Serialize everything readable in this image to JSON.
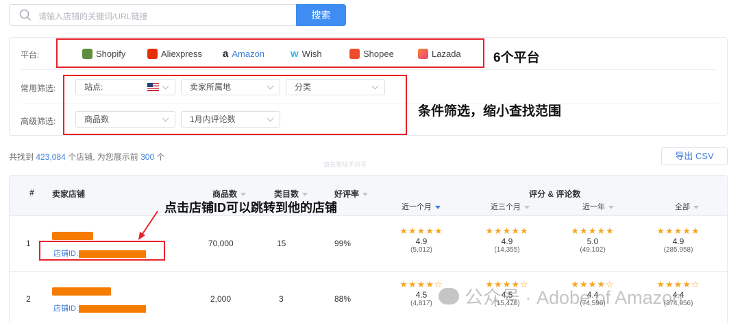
{
  "search": {
    "placeholder": "请输入店铺的关键词/URL链接",
    "button_label": "搜索"
  },
  "filters": {
    "platform_label": "平台:",
    "platforms": [
      {
        "name": "Shopify",
        "color": "#5e8e3e"
      },
      {
        "name": "Aliexpress",
        "color": "#e62e04"
      },
      {
        "name": "Amazon",
        "color": "#ff9900"
      },
      {
        "name": "Wish",
        "color": "#2fb7ec"
      },
      {
        "name": "Shopee",
        "color": "#ee4d2d"
      },
      {
        "name": "Lazada",
        "color": "#f0428c"
      }
    ],
    "platform_annotation": "6个平台",
    "common_label": "常用筛选:",
    "site_label": "站点:",
    "seller_location": "卖家所属地",
    "category": "分类",
    "advanced_label": "高级筛选:",
    "product_count": "商品数",
    "monthly_reviews": "1月内评论数",
    "filter_annotation": "条件筛选，缩小查找范围"
  },
  "summary": {
    "prefix": "共找到",
    "total": "423,084",
    "middle": "个店铺, 为您展示前",
    "shown": "300",
    "suffix": "个"
  },
  "export_label": "导出 CSV",
  "faint_text": "请去登陆手机号",
  "table": {
    "headers": {
      "rank": "#",
      "store": "卖家店铺",
      "products": "商品数",
      "categories": "类目数",
      "positive_rate": "好评率",
      "ratings": "评分 & 评论数"
    },
    "periods": [
      "近一个月",
      "近三个月",
      "近一年",
      "全部"
    ],
    "annotation": "点击店铺ID可以跳转到他的店铺",
    "store_id_prefix": "店铺ID:",
    "rows": [
      {
        "rank": "1",
        "products": "70,000",
        "categories": "15",
        "positive_rate": "99%",
        "ratings": [
          {
            "score": "4.9",
            "count": "(5,012)"
          },
          {
            "score": "4.9",
            "count": "(14,355)"
          },
          {
            "score": "5.0",
            "count": "(49,102)"
          },
          {
            "score": "4.9",
            "count": "(285,958)"
          }
        ]
      },
      {
        "rank": "2",
        "products": "2,000",
        "categories": "3",
        "positive_rate": "88%",
        "ratings": [
          {
            "score": "4.5",
            "count": "(4,817)"
          },
          {
            "score": "4.5",
            "count": "(15,476)"
          },
          {
            "score": "4.4",
            "count": "(74,596)"
          },
          {
            "score": "4.4",
            "count": "(374,956)"
          }
        ]
      }
    ]
  },
  "watermark": "公众号 · Adobe of Amazon"
}
